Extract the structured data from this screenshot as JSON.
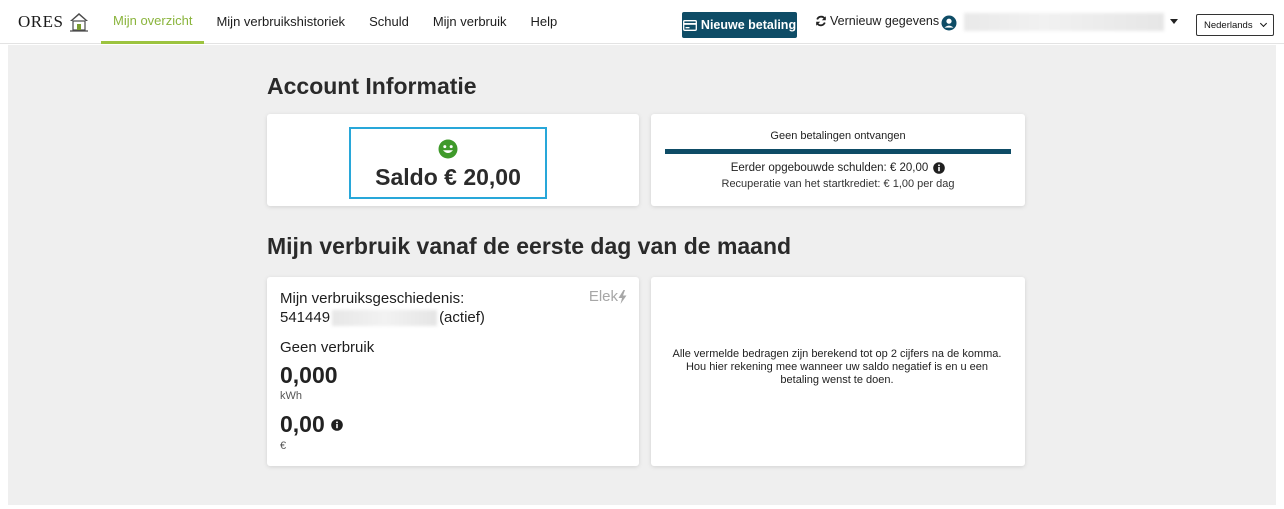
{
  "brand": {
    "name": "ORES"
  },
  "nav": {
    "items": [
      {
        "label": "Mijn overzicht",
        "active": true
      },
      {
        "label": "Mijn verbruikshistoriek",
        "active": false
      },
      {
        "label": "Schuld",
        "active": false
      },
      {
        "label": "Mijn verbruik",
        "active": false
      },
      {
        "label": "Help",
        "active": false
      }
    ],
    "new_payment_label": "Nieuwe betaling",
    "refresh_label": "Vernieuw gegevens",
    "language": "Nederlands"
  },
  "colors": {
    "accent_green": "#9cc33f",
    "primary_dark_blue": "#0e4c66",
    "highlight_blue": "#28a7d9",
    "smiley_green": "#3f9a2a"
  },
  "account": {
    "title": "Account Informatie",
    "saldo_text": "Saldo € 20,00",
    "payment_status": "Geen betalingen ontvangen",
    "previous_debts": "Eerder opgebouwde schulden: € 20,00",
    "recuperation": "Recuperatie van het startkrediet: € 1,00 per dag"
  },
  "usage": {
    "title": "Mijn verbruik vanaf de eerste dag van de maand",
    "history_label": "Mijn verbruiksgeschiedenis:",
    "meter_prefix": "541449",
    "meter_status": "(actief)",
    "energy_type": "Elek",
    "no_usage": "Geen verbruik",
    "kwh_value": "0,000",
    "kwh_unit": "kWh",
    "euro_value": "0,00",
    "euro_unit": "€",
    "note": "Alle vermelde bedragen zijn berekend tot op 2 cijfers na de komma. Hou hier rekening mee wanneer uw saldo negatief is en u een betaling wenst te doen."
  }
}
